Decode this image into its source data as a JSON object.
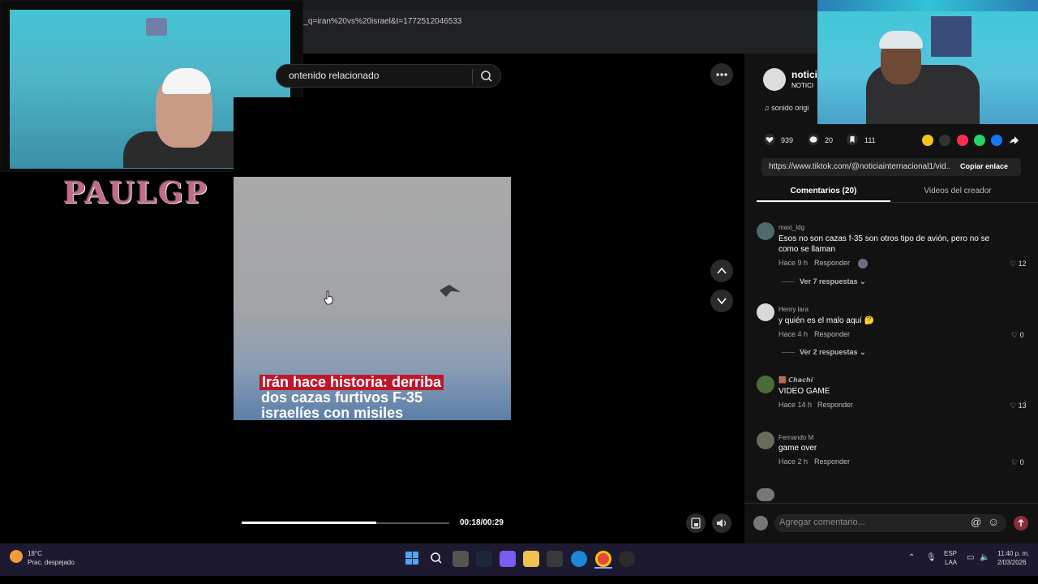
{
  "browser": {
    "url": "50C_q=iran%20vs%20israel&t=1772512046533"
  },
  "streamer": {
    "brand": "PAULGP"
  },
  "search": {
    "text": "ontenido relacionado"
  },
  "video": {
    "caption_line1": "Irán hace historia: derriba",
    "caption_line2": "dos cazas furtivos F-35",
    "caption_line3": "israelíes con misiles",
    "time": "00:18/00:29",
    "progress_fraction": 0.65
  },
  "author": {
    "name": "notici",
    "sub": "NOTICI",
    "sound": "sonido origi"
  },
  "stats": {
    "likes": "939",
    "comments": "20",
    "saves": "111"
  },
  "link": {
    "url": "https://www.tiktok.com/@noticiainternacional1/vid...",
    "copy_label": "Copiar enlace"
  },
  "tabs": {
    "comments": "Comentarios (20)",
    "creator": "Videos del creador"
  },
  "comments": [
    {
      "user": "maxi_ldg",
      "text_line1": "Esos no son cazas f-35 son otros tipo de avión, pero no se",
      "text_line2": "como se llaman",
      "time": "Hace 9 h",
      "reply": "Responder",
      "likes": "12",
      "more": "Ver 7 respuestas"
    },
    {
      "user": "Henry lara",
      "text_line1": "y quién es el malo aquí 🤔",
      "time": "Hace 4 h",
      "reply": "Responder",
      "likes": "0",
      "more": "Ver 2 respuestas"
    },
    {
      "user": "🟫 𝘾𝙝𝙖𝙘𝙝𝙞",
      "text_line1": "VIDEO GAME",
      "time": "Hace 14 h",
      "reply": "Responder",
      "likes": "13"
    },
    {
      "user": "Fernando M",
      "text_line1": "game over",
      "time": "Hace 2 h",
      "reply": "Responder",
      "likes": "0"
    }
  ],
  "add_comment": {
    "placeholder": "Agregar comentario..."
  },
  "taskbar": {
    "weather_temp": "18°C",
    "weather_desc": "Prac. despejado",
    "lang1": "ESP",
    "lang2": "LAA",
    "time": "11:40 p. m.",
    "date": "2/03/2026"
  },
  "colors": {
    "accent_red": "#c0152a",
    "taskbar": "#1c1930",
    "panel": "#121212"
  }
}
